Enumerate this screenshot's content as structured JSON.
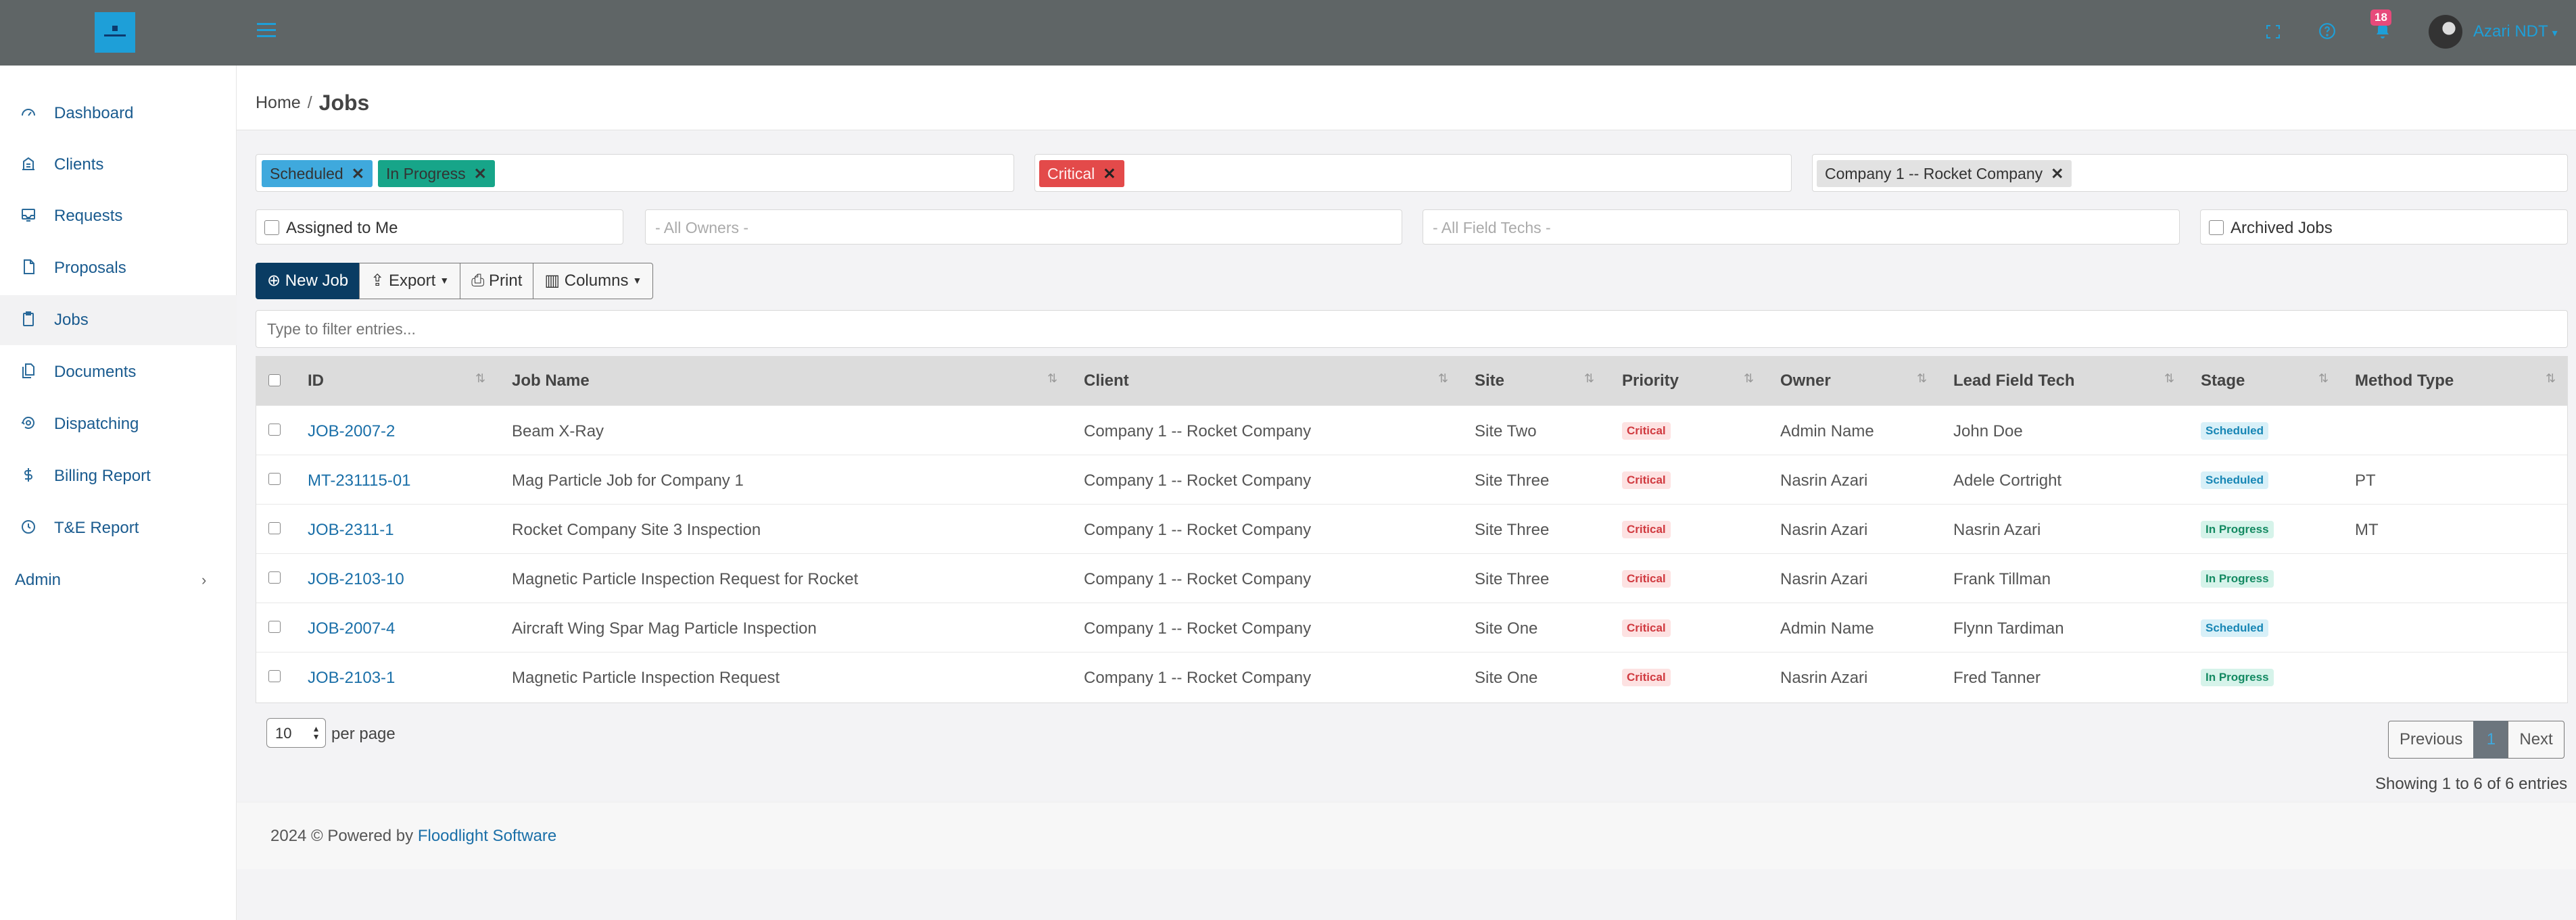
{
  "header": {
    "username": "Azari NDT",
    "notification_count": "18",
    "colors": {
      "bar": "#5f6566",
      "accent": "#1e9fd8",
      "badge": "#e74a7b"
    }
  },
  "sidebar": {
    "items": [
      {
        "label": "Dashboard",
        "icon": "dashboard-icon"
      },
      {
        "label": "Clients",
        "icon": "building-icon"
      },
      {
        "label": "Requests",
        "icon": "inbox-icon"
      },
      {
        "label": "Proposals",
        "icon": "document-icon"
      },
      {
        "label": "Jobs",
        "icon": "clipboard-icon"
      },
      {
        "label": "Documents",
        "icon": "files-icon"
      },
      {
        "label": "Dispatching",
        "icon": "dispatch-icon"
      },
      {
        "label": "Billing Report",
        "icon": "dollar-icon"
      },
      {
        "label": "T&E Report",
        "icon": "clock-icon"
      }
    ],
    "admin_label": "Admin"
  },
  "breadcrumb": {
    "home": "Home",
    "current": "Jobs"
  },
  "filters": {
    "stage_tags": [
      "Scheduled",
      "In Progress"
    ],
    "priority_tags": [
      "Critical"
    ],
    "client_tags": [
      "Company 1 -- Rocket Company"
    ],
    "assigned_to_me": "Assigned to Me",
    "owners_placeholder": "- All Owners -",
    "field_techs_placeholder": "- All Field Techs -",
    "archived_jobs": "Archived Jobs"
  },
  "toolbar": {
    "new_job": "New Job",
    "export": "Export",
    "print": "Print",
    "columns": "Columns"
  },
  "search": {
    "placeholder": "Type to filter entries..."
  },
  "table": {
    "columns": [
      "ID",
      "Job Name",
      "Client",
      "Site",
      "Priority",
      "Owner",
      "Lead Field Tech",
      "Stage",
      "Method Type"
    ],
    "rows": [
      {
        "id": "JOB-2007-2",
        "name": "Beam X-Ray",
        "client": "Company 1 -- Rocket Company",
        "site": "Site Two",
        "priority": "Critical",
        "owner": "Admin Name",
        "tech": "John Doe",
        "stage": "Scheduled",
        "method": ""
      },
      {
        "id": "MT-231115-01",
        "name": "Mag Particle Job for Company 1",
        "client": "Company 1 -- Rocket Company",
        "site": "Site Three",
        "priority": "Critical",
        "owner": "Nasrin Azari",
        "tech": "Adele Cortright",
        "stage": "Scheduled",
        "method": "PT"
      },
      {
        "id": "JOB-2311-1",
        "name": "Rocket Company Site 3 Inspection",
        "client": "Company 1 -- Rocket Company",
        "site": "Site Three",
        "priority": "Critical",
        "owner": "Nasrin Azari",
        "tech": "Nasrin Azari",
        "stage": "In Progress",
        "method": "MT"
      },
      {
        "id": "JOB-2103-10",
        "name": "Magnetic Particle Inspection Request for Rocket",
        "client": "Company 1 -- Rocket Company",
        "site": "Site Three",
        "priority": "Critical",
        "owner": "Nasrin Azari",
        "tech": "Frank Tillman",
        "stage": "In Progress",
        "method": ""
      },
      {
        "id": "JOB-2007-4",
        "name": "Aircraft Wing Spar Mag Particle Inspection",
        "client": "Company 1 -- Rocket Company",
        "site": "Site One",
        "priority": "Critical",
        "owner": "Admin Name",
        "tech": "Flynn Tardiman",
        "stage": "Scheduled",
        "method": ""
      },
      {
        "id": "JOB-2103-1",
        "name": "Magnetic Particle Inspection Request",
        "client": "Company 1 -- Rocket Company",
        "site": "Site One",
        "priority": "Critical",
        "owner": "Nasrin Azari",
        "tech": "Fred Tanner",
        "stage": "In Progress",
        "method": ""
      }
    ]
  },
  "pagination": {
    "per_page_value": "10",
    "per_page_label": "per page",
    "previous": "Previous",
    "current_page": "1",
    "next": "Next",
    "showing": "Showing 1 to 6 of 6 entries"
  },
  "footer": {
    "text": "2024 © Powered by",
    "link": "Floodlight Software"
  }
}
